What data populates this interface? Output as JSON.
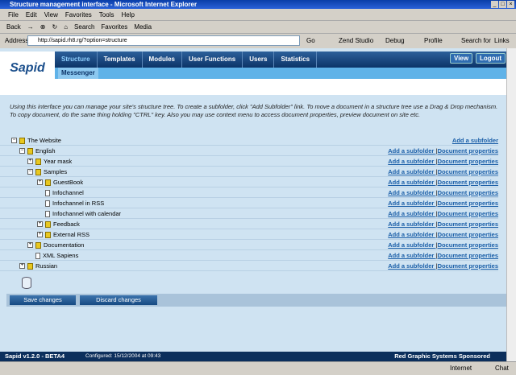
{
  "window": {
    "title": "Structure management interface - Microsoft Internet Explorer"
  },
  "menu": [
    "File",
    "Edit",
    "View",
    "Favorites",
    "Tools",
    "Help"
  ],
  "toolbar": {
    "back": "Back",
    "search": "Search",
    "favorites": "Favorites",
    "media": "Media"
  },
  "address": {
    "label": "Address",
    "url": "http://sapid.rh8.rg/?option=structure",
    "go": "Go",
    "zend": "Zend Studio",
    "debug": "Debug",
    "profile": "Profile",
    "search_for": "Search for",
    "links": "Links"
  },
  "app": {
    "logo": "Sapid",
    "nav": [
      "Structure",
      "Templates",
      "Modules",
      "User Functions",
      "Users",
      "Statistics"
    ],
    "subnav": "Messenger",
    "view": "View",
    "logout": "Logout"
  },
  "intro": "Using this interface you can manage your site's structure tree. To create a subfolder, click \"Add Subfolder\" link. To move a document in a structure tree use a Drag & Drop mechanism. To copy document, do the same thing holding \"CTRL\" key. Also you may use context menu to access document properties, preview document on site etc.",
  "links": {
    "add": "Add a subfolder",
    "props": "Document properties",
    "sep": "|"
  },
  "tree": [
    {
      "label": "The Website",
      "level": 0,
      "type": "folder",
      "toggle": "-"
    },
    {
      "label": "English",
      "level": 1,
      "type": "folder",
      "toggle": "-"
    },
    {
      "label": "Year mask",
      "level": 2,
      "type": "folder",
      "toggle": "+"
    },
    {
      "label": "Samples",
      "level": 2,
      "type": "folder",
      "toggle": "-"
    },
    {
      "label": "GuestBook",
      "level": 3,
      "type": "folder",
      "toggle": "+"
    },
    {
      "label": "Infochannel",
      "level": 3,
      "type": "doc"
    },
    {
      "label": "Infochannel in RSS",
      "level": 3,
      "type": "doc"
    },
    {
      "label": "Infochannel with calendar",
      "level": 3,
      "type": "doc"
    },
    {
      "label": "Feedback",
      "level": 3,
      "type": "folder",
      "toggle": "+"
    },
    {
      "label": "External RSS",
      "level": 3,
      "type": "folder",
      "toggle": "+"
    },
    {
      "label": "Documentation",
      "level": 2,
      "type": "folder",
      "toggle": "+"
    },
    {
      "label": "XML Sapiens",
      "level": 2,
      "type": "doc"
    },
    {
      "label": "Russian",
      "level": 1,
      "type": "folder",
      "toggle": "+"
    }
  ],
  "buttons": {
    "save": "Save changes",
    "discard": "Discard changes"
  },
  "footer": {
    "version": "Sapid v1.2.0 - BETA4",
    "configured": "Configured: 15/12/2004 at 09:43",
    "sponsor": "Red Graphic Systems Sponsored"
  },
  "status": {
    "zone": "Internet",
    "chat": "Chat"
  }
}
